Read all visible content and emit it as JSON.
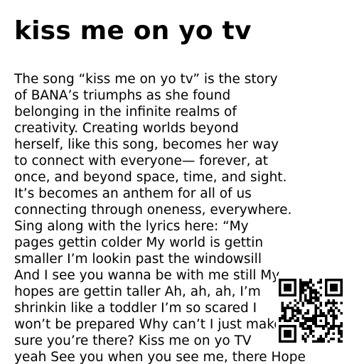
{
  "title": "kiss me on yo tv",
  "body_lines": [
    "The song “kiss me on yo tv” is the story",
    "of BANA’s triumphs as she found",
    "belonging in the infinite realms of",
    "creativity. Creating worlds beyond",
    "herself, like this song, becomes her way",
    "to connect with everyone— forever, at",
    "once, and beyond space, time, and sight.",
    "It’s becomes an anthem for all of us",
    "connecting through oneness, everywhere.",
    "Sing along with the lyrics here: “My",
    "pages gettin colder My world is gettin",
    "smaller I’m lookin past the windowsill",
    "And I see you wanna be with me still My",
    "hopes are gettin taller Ah, ah, ah, I’m",
    "shrinkin like a toddler I’m so scared I",
    "won’t be prepared Why can’t I just make",
    "sure you’re there? Kiss me on yo TV",
    "yeah See you when you see me, there Hope"
  ],
  "qr_code": {
    "icon": "qr-code-icon",
    "dark_color": "#000000",
    "light_color": "#ffffff"
  }
}
